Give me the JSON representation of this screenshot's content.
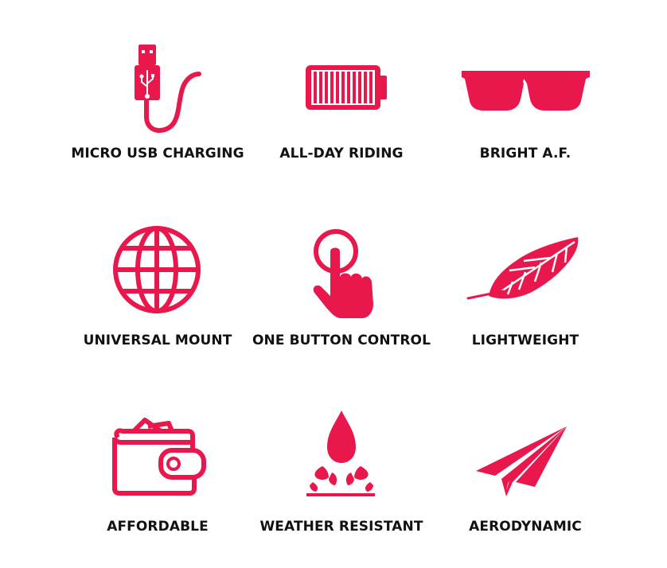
{
  "accent_color": "#e8174c",
  "features": [
    {
      "label": "MICRO USB CHARGING",
      "icon": "usb-cable-icon"
    },
    {
      "label": "ALL-DAY RIDING",
      "icon": "battery-icon"
    },
    {
      "label": "BRIGHT A.F.",
      "icon": "sunglasses-icon"
    },
    {
      "label": "UNIVERSAL MOUNT",
      "icon": "globe-icon"
    },
    {
      "label": "ONE BUTTON CONTROL",
      "icon": "finger-tap-icon"
    },
    {
      "label": "LIGHTWEIGHT",
      "icon": "feather-icon"
    },
    {
      "label": "AFFORDABLE",
      "icon": "wallet-icon"
    },
    {
      "label": "WEATHER RESISTANT",
      "icon": "water-drop-icon"
    },
    {
      "label": "AERODYNAMIC",
      "icon": "paper-plane-icon"
    }
  ]
}
